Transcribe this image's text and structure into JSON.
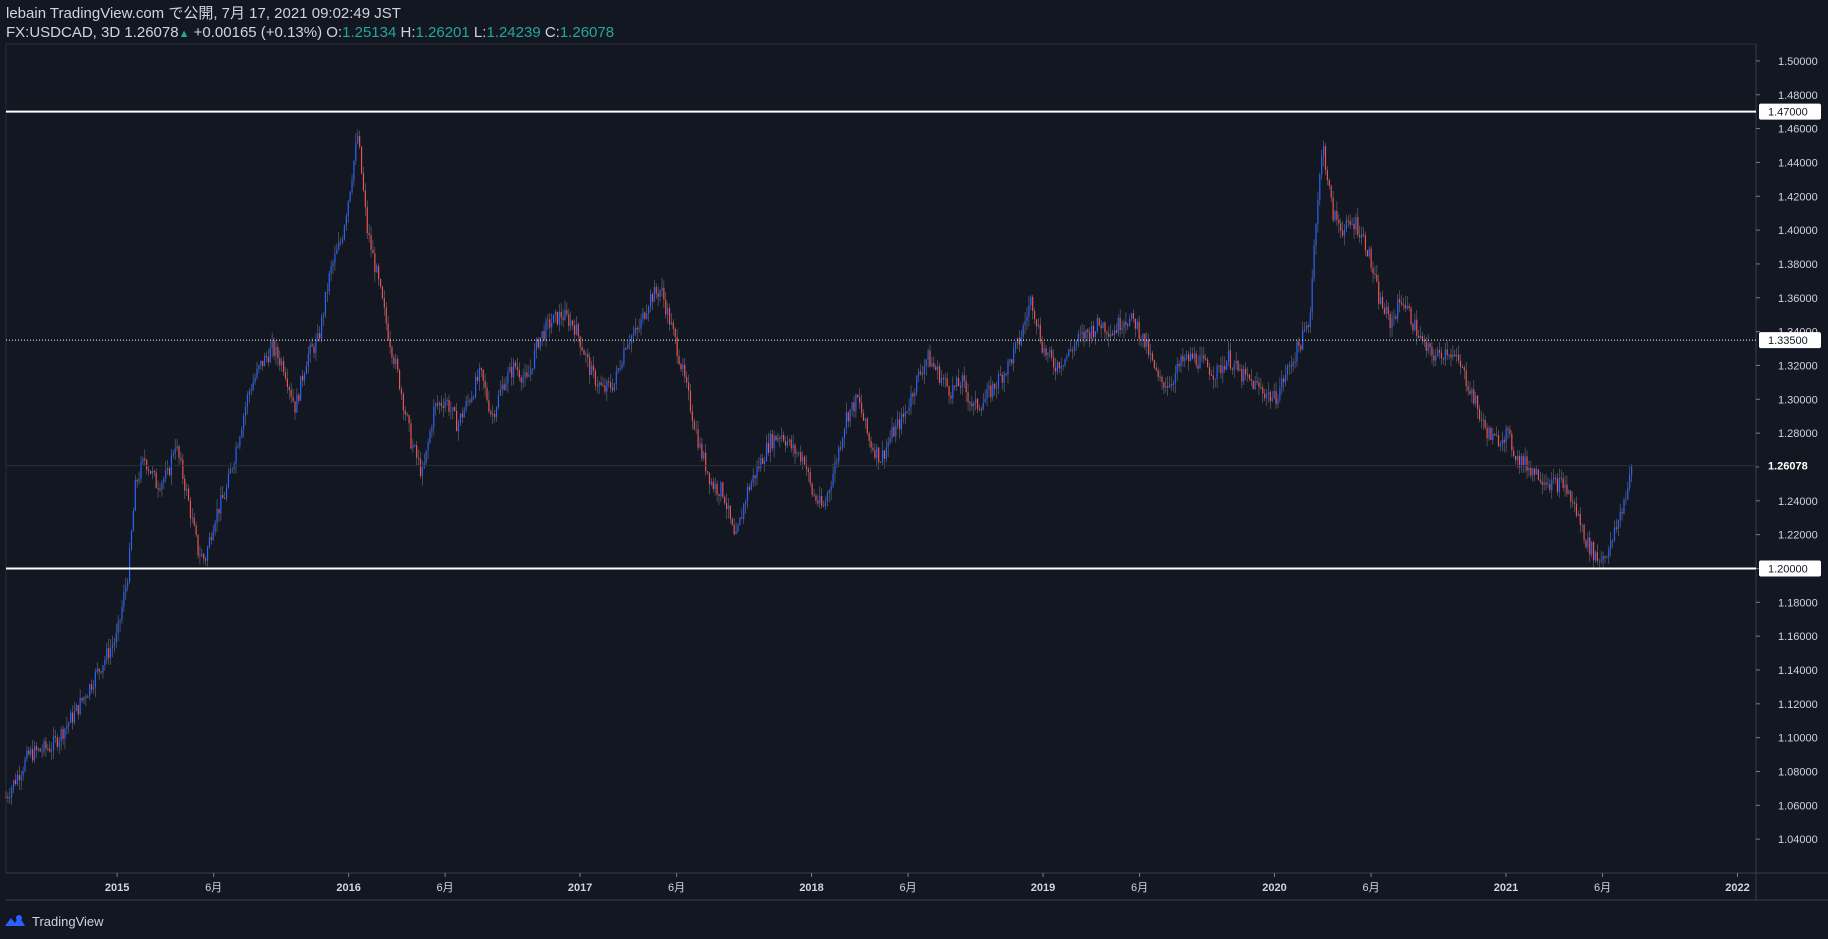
{
  "header": {
    "publish_line": "lebain TradingView.com で公開, 7月 17, 2021 09:02:49 JST",
    "symbol": "FX:USDCAD, 3D",
    "last": "1.26078",
    "change": "+0.00165 (+0.13%)",
    "o_label": "O:",
    "o_value": "1.25134",
    "h_label": "H:",
    "h_value": "1.26201",
    "l_label": "L:",
    "l_value": "1.24239",
    "c_label": "C:",
    "c_value": "1.26078"
  },
  "footer": {
    "brand": "TradingView",
    "logo_icon": "tradingview-logo-icon"
  },
  "colors": {
    "background": "#131722",
    "up": "#2962ff",
    "down": "#ef5350",
    "text": "#d1d4dc",
    "grid": "#2a2e39",
    "level": "#ffffff"
  },
  "chart_data": {
    "type": "candlestick",
    "symbol": "FX:USDCAD",
    "interval": "3D",
    "ylim": [
      1.02,
      1.51
    ],
    "y_ticks": [
      "1.04000",
      "1.06000",
      "1.08000",
      "1.10000",
      "1.12000",
      "1.14000",
      "1.16000",
      "1.18000",
      "1.20000",
      "1.22000",
      "1.24000",
      "1.26000",
      "1.28000",
      "1.30000",
      "1.32000",
      "1.34000",
      "1.36000",
      "1.38000",
      "1.40000",
      "1.42000",
      "1.44000",
      "1.46000",
      "1.48000",
      "1.50000"
    ],
    "x_ticks": [
      {
        "t": 2015.0,
        "label": "2015"
      },
      {
        "t": 2015.417,
        "label": "6月"
      },
      {
        "t": 2016.0,
        "label": "2016"
      },
      {
        "t": 2016.417,
        "label": "6月"
      },
      {
        "t": 2017.0,
        "label": "2017"
      },
      {
        "t": 2017.417,
        "label": "6月"
      },
      {
        "t": 2018.0,
        "label": "2018"
      },
      {
        "t": 2018.417,
        "label": "6月"
      },
      {
        "t": 2019.0,
        "label": "2019"
      },
      {
        "t": 2019.417,
        "label": "6月"
      },
      {
        "t": 2020.0,
        "label": "2020"
      },
      {
        "t": 2020.417,
        "label": "6月"
      },
      {
        "t": 2021.0,
        "label": "2021"
      },
      {
        "t": 2021.417,
        "label": "6月"
      },
      {
        "t": 2022.0,
        "label": "2022"
      }
    ],
    "xlim": [
      2014.52,
      2022.08
    ],
    "price_path": [
      [
        2014.52,
        1.065
      ],
      [
        2014.62,
        1.09
      ],
      [
        2014.72,
        1.095
      ],
      [
        2014.82,
        1.115
      ],
      [
        2014.9,
        1.135
      ],
      [
        2015.0,
        1.16
      ],
      [
        2015.05,
        1.2
      ],
      [
        2015.08,
        1.25
      ],
      [
        2015.12,
        1.265
      ],
      [
        2015.17,
        1.25
      ],
      [
        2015.22,
        1.255
      ],
      [
        2015.25,
        1.275
      ],
      [
        2015.3,
        1.245
      ],
      [
        2015.35,
        1.21
      ],
      [
        2015.38,
        1.205
      ],
      [
        2015.42,
        1.23
      ],
      [
        2015.47,
        1.245
      ],
      [
        2015.52,
        1.275
      ],
      [
        2015.57,
        1.305
      ],
      [
        2015.62,
        1.32
      ],
      [
        2015.67,
        1.33
      ],
      [
        2015.72,
        1.32
      ],
      [
        2015.77,
        1.295
      ],
      [
        2015.82,
        1.325
      ],
      [
        2015.87,
        1.335
      ],
      [
        2015.92,
        1.375
      ],
      [
        2015.97,
        1.395
      ],
      [
        2016.0,
        1.42
      ],
      [
        2016.04,
        1.456
      ],
      [
        2016.08,
        1.4
      ],
      [
        2016.12,
        1.375
      ],
      [
        2016.17,
        1.34
      ],
      [
        2016.22,
        1.31
      ],
      [
        2016.27,
        1.275
      ],
      [
        2016.32,
        1.255
      ],
      [
        2016.37,
        1.295
      ],
      [
        2016.42,
        1.3
      ],
      [
        2016.47,
        1.285
      ],
      [
        2016.52,
        1.3
      ],
      [
        2016.57,
        1.315
      ],
      [
        2016.62,
        1.29
      ],
      [
        2016.67,
        1.31
      ],
      [
        2016.72,
        1.32
      ],
      [
        2016.77,
        1.31
      ],
      [
        2016.82,
        1.335
      ],
      [
        2016.87,
        1.345
      ],
      [
        2016.92,
        1.35
      ],
      [
        2016.97,
        1.345
      ],
      [
        2017.0,
        1.335
      ],
      [
        2017.05,
        1.315
      ],
      [
        2017.1,
        1.305
      ],
      [
        2017.15,
        1.31
      ],
      [
        2017.2,
        1.335
      ],
      [
        2017.25,
        1.34
      ],
      [
        2017.3,
        1.36
      ],
      [
        2017.35,
        1.365
      ],
      [
        2017.38,
        1.35
      ],
      [
        2017.42,
        1.33
      ],
      [
        2017.47,
        1.3
      ],
      [
        2017.52,
        1.27
      ],
      [
        2017.57,
        1.25
      ],
      [
        2017.62,
        1.245
      ],
      [
        2017.67,
        1.215
      ],
      [
        2017.72,
        1.245
      ],
      [
        2017.77,
        1.26
      ],
      [
        2017.82,
        1.275
      ],
      [
        2017.87,
        1.28
      ],
      [
        2017.92,
        1.27
      ],
      [
        2017.97,
        1.265
      ],
      [
        2018.0,
        1.245
      ],
      [
        2018.05,
        1.235
      ],
      [
        2018.1,
        1.26
      ],
      [
        2018.15,
        1.29
      ],
      [
        2018.2,
        1.3
      ],
      [
        2018.25,
        1.275
      ],
      [
        2018.3,
        1.265
      ],
      [
        2018.35,
        1.28
      ],
      [
        2018.4,
        1.29
      ],
      [
        2018.45,
        1.31
      ],
      [
        2018.5,
        1.325
      ],
      [
        2018.55,
        1.315
      ],
      [
        2018.6,
        1.305
      ],
      [
        2018.65,
        1.31
      ],
      [
        2018.7,
        1.295
      ],
      [
        2018.75,
        1.3
      ],
      [
        2018.8,
        1.31
      ],
      [
        2018.85,
        1.32
      ],
      [
        2018.9,
        1.335
      ],
      [
        2018.95,
        1.36
      ],
      [
        2019.0,
        1.33
      ],
      [
        2019.05,
        1.32
      ],
      [
        2019.1,
        1.325
      ],
      [
        2019.15,
        1.335
      ],
      [
        2019.2,
        1.34
      ],
      [
        2019.25,
        1.345
      ],
      [
        2019.3,
        1.34
      ],
      [
        2019.35,
        1.348
      ],
      [
        2019.4,
        1.345
      ],
      [
        2019.45,
        1.33
      ],
      [
        2019.5,
        1.31
      ],
      [
        2019.55,
        1.31
      ],
      [
        2019.6,
        1.322
      ],
      [
        2019.65,
        1.325
      ],
      [
        2019.7,
        1.32
      ],
      [
        2019.75,
        1.315
      ],
      [
        2019.8,
        1.325
      ],
      [
        2019.85,
        1.315
      ],
      [
        2019.9,
        1.31
      ],
      [
        2019.95,
        1.305
      ],
      [
        2020.0,
        1.3
      ],
      [
        2020.05,
        1.315
      ],
      [
        2020.1,
        1.33
      ],
      [
        2020.15,
        1.345
      ],
      [
        2020.18,
        1.41
      ],
      [
        2020.21,
        1.45
      ],
      [
        2020.25,
        1.41
      ],
      [
        2020.3,
        1.4
      ],
      [
        2020.35,
        1.405
      ],
      [
        2020.4,
        1.39
      ],
      [
        2020.45,
        1.36
      ],
      [
        2020.5,
        1.345
      ],
      [
        2020.55,
        1.36
      ],
      [
        2020.6,
        1.345
      ],
      [
        2020.65,
        1.33
      ],
      [
        2020.7,
        1.325
      ],
      [
        2020.75,
        1.33
      ],
      [
        2020.8,
        1.32
      ],
      [
        2020.85,
        1.305
      ],
      [
        2020.9,
        1.285
      ],
      [
        2020.95,
        1.275
      ],
      [
        2021.0,
        1.28
      ],
      [
        2021.05,
        1.265
      ],
      [
        2021.1,
        1.26
      ],
      [
        2021.15,
        1.255
      ],
      [
        2021.2,
        1.25
      ],
      [
        2021.25,
        1.25
      ],
      [
        2021.3,
        1.235
      ],
      [
        2021.35,
        1.215
      ],
      [
        2021.4,
        1.205
      ],
      [
        2021.45,
        1.212
      ],
      [
        2021.5,
        1.235
      ],
      [
        2021.55,
        1.26
      ]
    ],
    "last_price": 1.26078,
    "horizontal_lines": [
      {
        "price": 1.47,
        "label": "1.47000",
        "style": "solid"
      },
      {
        "price": 1.335,
        "label": "1.33500",
        "style": "dotted"
      },
      {
        "price": 1.2,
        "label": "1.20000",
        "style": "solid"
      }
    ],
    "last_price_label": "1.26078"
  }
}
